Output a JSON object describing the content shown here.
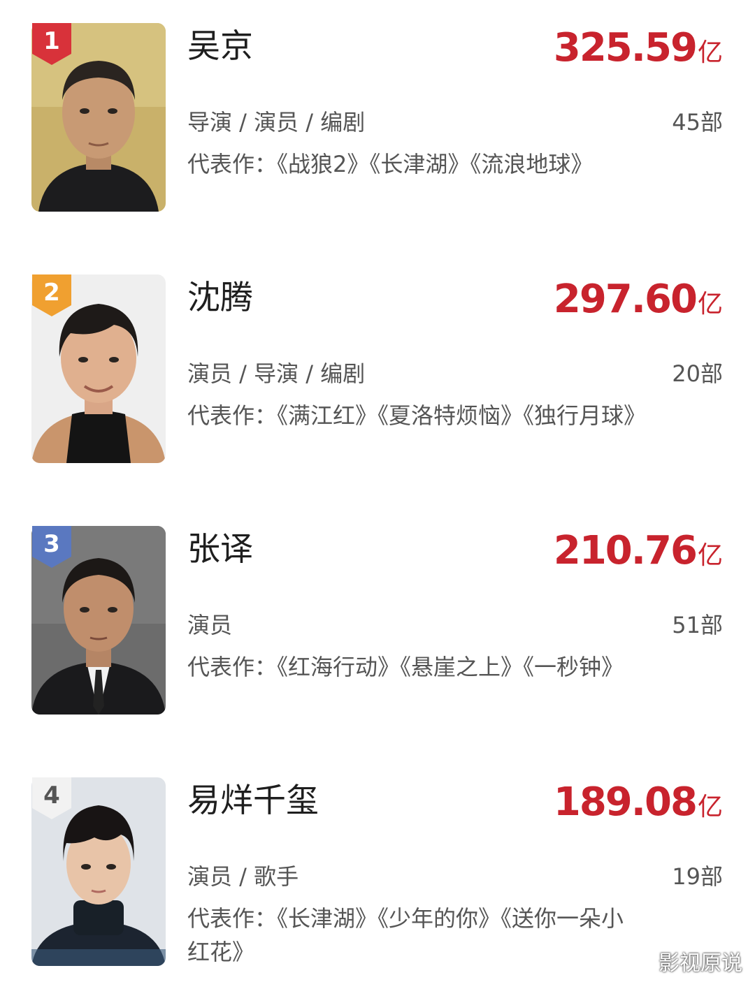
{
  "items": [
    {
      "rank": "1",
      "name": "吴京",
      "box_value": "325.59",
      "box_unit": "亿",
      "roles": "导演 / 演员 / 编剧",
      "film_count": "45部",
      "works": "代表作：《战狼2》《长津湖》《流浪地球》"
    },
    {
      "rank": "2",
      "name": "沈腾",
      "box_value": "297.60",
      "box_unit": "亿",
      "roles": "演员 / 导演 / 编剧",
      "film_count": "20部",
      "works": "代表作：《满江红》《夏洛特烦恼》《独行月球》"
    },
    {
      "rank": "3",
      "name": "张译",
      "box_value": "210.76",
      "box_unit": "亿",
      "roles": "演员",
      "film_count": "51部",
      "works": "代表作：《红海行动》《悬崖之上》《一秒钟》"
    },
    {
      "rank": "4",
      "name": "易烊千玺",
      "box_value": "189.08",
      "box_unit": "亿",
      "roles": "演员 / 歌手",
      "film_count": "19部",
      "works": "代表作：《长津湖》《少年的你》《送你一朵小红花》"
    }
  ],
  "colors": {
    "accent": "#c8232d",
    "badge_1": "#d8323a",
    "badge_2": "#f0a030",
    "badge_3": "#5a78c0",
    "badge_4": "#f2f2f2"
  },
  "watermark": "影视原说"
}
